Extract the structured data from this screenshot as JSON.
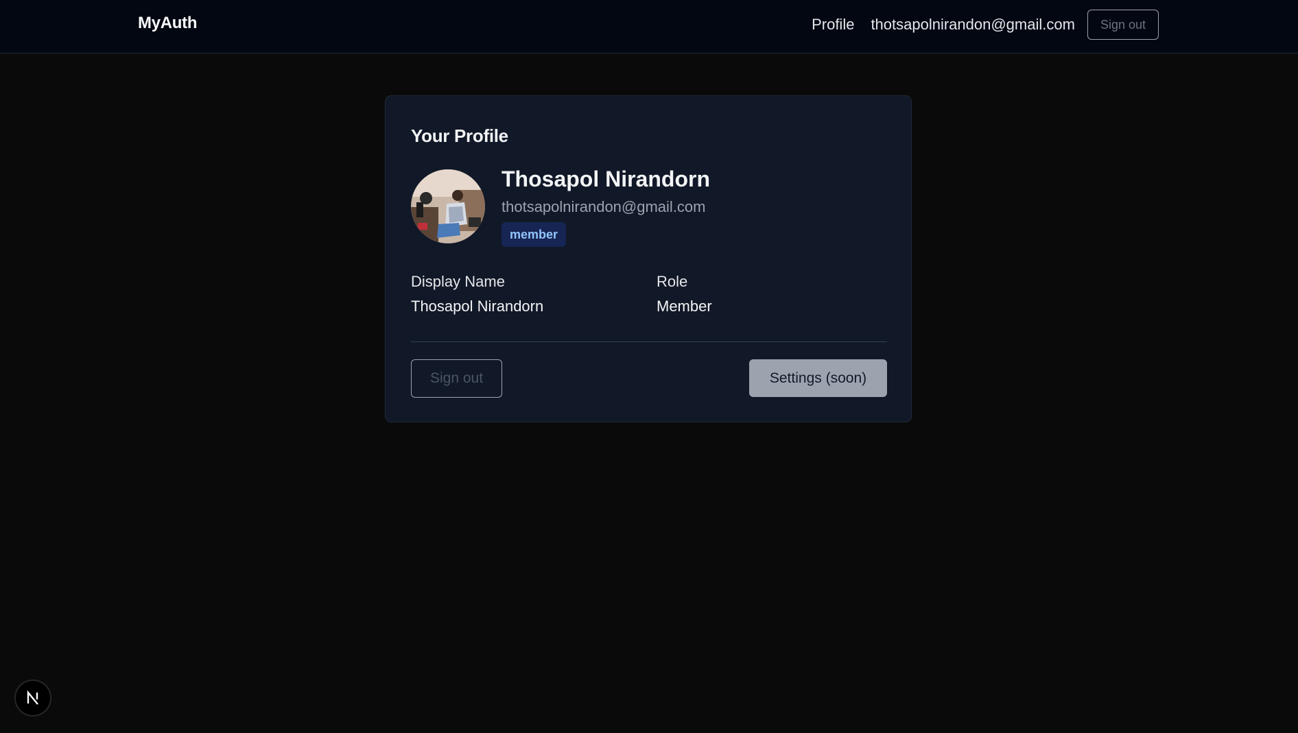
{
  "header": {
    "brand": "MyAuth",
    "nav_profile": "Profile",
    "nav_email": "thotsapolnirandon@gmail.com",
    "signout_label": "Sign out"
  },
  "profile": {
    "title": "Your Profile",
    "name": "Thosapol Nirandorn",
    "email": "thotsapolnirandon@gmail.com",
    "role_badge": "member",
    "fields": {
      "display_name_label": "Display Name",
      "display_name_value": "Thosapol Nirandorn",
      "role_label": "Role",
      "role_value": "Member"
    },
    "signout_label": "Sign out",
    "settings_label": "Settings (soon)"
  },
  "dev_badge": {
    "icon": "nextjs-icon",
    "letter": "N"
  },
  "colors": {
    "page_bg": "#0a0a0a",
    "header_bg": "#030712",
    "card_bg": "#111827",
    "badge_bg": "#172554",
    "badge_text": "#93c5fd",
    "settings_bg": "#9ca3af"
  }
}
